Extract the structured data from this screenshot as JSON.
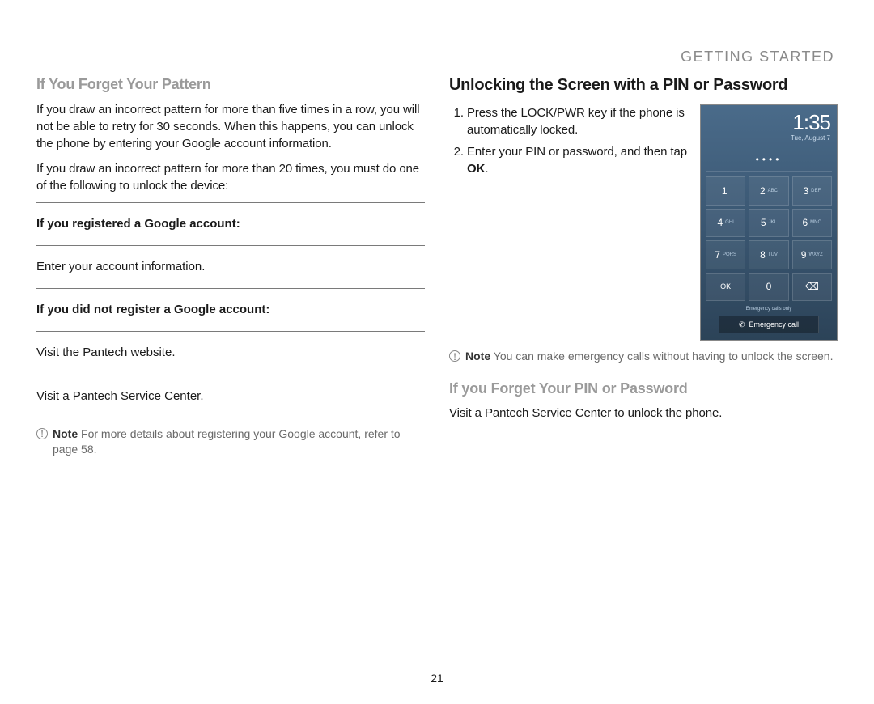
{
  "header": "GETTING STARTED",
  "page_number": "21",
  "left": {
    "h1": "If You Forget Your Pattern",
    "p1": "If you draw an incorrect pattern for more than five times in a row, you will not be able to retry for 30 seconds. When this happens, you can unlock the phone by entering your Google account information.",
    "p2": "If you draw an incorrect pattern for more than 20 times, you must do one of the following to unlock the device:",
    "row1_label": "If you registered a Google account:",
    "row1_val": "Enter your account information.",
    "row2_label": "If you did not register a Google account:",
    "row2_val1": "Visit the Pantech website.",
    "row2_val2": "Visit a Pantech Service Center.",
    "note_label": "Note",
    "note_text": " For more details about registering your Google account, refer to page 58."
  },
  "right": {
    "h1": "Unlocking the Screen with a PIN or Password",
    "step1": "Press the LOCK/PWR key if the phone is automatically locked.",
    "step2_a": "Enter your PIN or password, and then tap ",
    "step2_b": "OK",
    "step2_c": ".",
    "note_label": "Note",
    "note_text": " You can make emergency calls without having to unlock the screen.",
    "h2": "If you Forget Your PIN or Password",
    "p2": "Visit a Pantech Service Center to unlock the phone."
  },
  "phone": {
    "time": "1:35",
    "date": "Tue, August 7",
    "pin": "••••",
    "keys": [
      {
        "n": "1",
        "l": ""
      },
      {
        "n": "2",
        "l": "ABC"
      },
      {
        "n": "3",
        "l": "DEF"
      },
      {
        "n": "4",
        "l": "GHI"
      },
      {
        "n": "5",
        "l": "JKL"
      },
      {
        "n": "6",
        "l": "MNO"
      },
      {
        "n": "7",
        "l": "PQRS"
      },
      {
        "n": "8",
        "l": "TUV"
      },
      {
        "n": "9",
        "l": "WXYZ"
      },
      {
        "n": "OK",
        "l": ""
      },
      {
        "n": "0",
        "l": ""
      },
      {
        "n": "⌫",
        "l": ""
      }
    ],
    "emerg_label": "Emergency calls only",
    "emerg_btn": "Emergency call"
  }
}
